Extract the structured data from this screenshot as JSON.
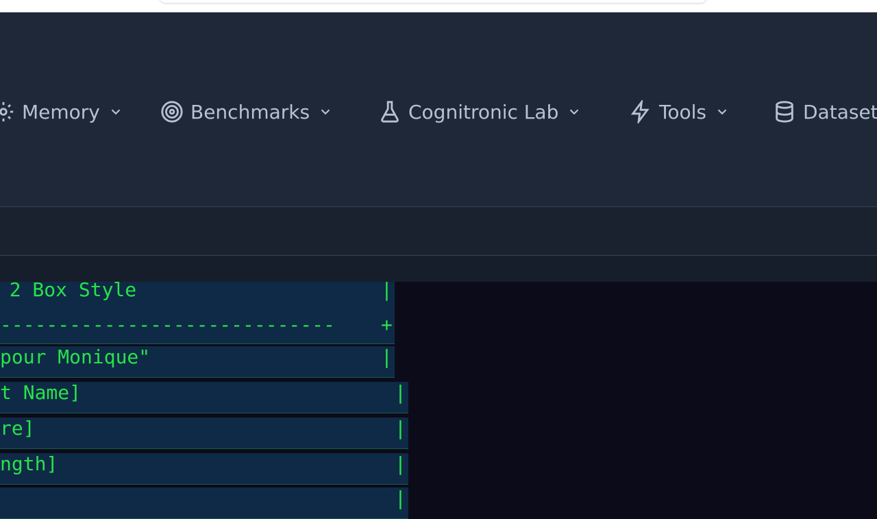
{
  "nav": {
    "items": [
      {
        "label": "Memory",
        "icon": "gear-icon"
      },
      {
        "label": "Benchmarks",
        "icon": "target-icon"
      },
      {
        "label": "Cognitronic Lab",
        "icon": "flask-icon"
      },
      {
        "label": "Tools",
        "icon": "lightning-icon"
      },
      {
        "label": "Datasets",
        "icon": "database-icon"
      }
    ]
  },
  "terminal": {
    "lines": [
      {
        "text": "  2 Box Style",
        "end": "|"
      },
      {
        "text": "-----------------------------",
        "end": "+"
      },
      {
        "text": "pour Monique\"",
        "end": "|"
      },
      {
        "text": "t Name]",
        "end": "|"
      },
      {
        "text": "re]",
        "end": "|"
      },
      {
        "text": "ngth]",
        "end": "|"
      },
      {
        "text": "",
        "end": "|"
      }
    ]
  },
  "colors": {
    "terminal_text": "#27e34a",
    "navbar_bg": "#1f2838",
    "terminal_bg": "#0b0b1a"
  }
}
